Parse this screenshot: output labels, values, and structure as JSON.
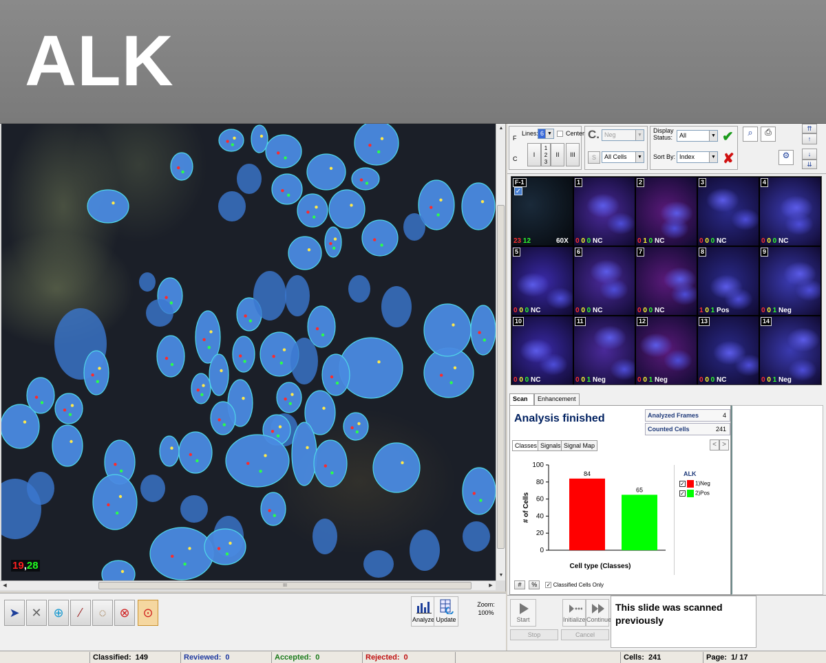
{
  "banner": {
    "title": "ALK"
  },
  "viewer": {
    "count_red": "19",
    "count_sep": ",",
    "count_green": "28",
    "hscroll_grip": "III"
  },
  "toolbar": {
    "analyze_label": "Analyze",
    "update_label": "Update",
    "zoom_label": "Zoom:",
    "zoom_value": "100%"
  },
  "controls": {
    "f_label": "F",
    "c_label": "C",
    "lines_label": "Lines:",
    "lines_value": "6",
    "center_label": "Center",
    "line_options": [
      "I",
      "1\n2\n3",
      "II",
      "III"
    ],
    "c_big": "C.",
    "neg_select": "Neg",
    "s_button": "S",
    "cells_select": "All Cells",
    "display_status_label": "Display Status:",
    "display_status_value": "All",
    "sort_by_label": "Sort By:",
    "sort_by_value": "Index"
  },
  "thumbnails": [
    {
      "num": "F-1",
      "c1": "23",
      "c2": "12",
      "c3": "",
      "label": "60X"
    },
    {
      "num": "1",
      "c1": "0",
      "c2": "0",
      "c3": "0",
      "label": "NC"
    },
    {
      "num": "2",
      "c1": "0",
      "c2": "1",
      "c3": "0",
      "label": "NC"
    },
    {
      "num": "3",
      "c1": "0",
      "c2": "0",
      "c3": "0",
      "label": "NC"
    },
    {
      "num": "4",
      "c1": "0",
      "c2": "0",
      "c3": "0",
      "label": "NC"
    },
    {
      "num": "5",
      "c1": "0",
      "c2": "0",
      "c3": "0",
      "label": "NC"
    },
    {
      "num": "6",
      "c1": "0",
      "c2": "0",
      "c3": "0",
      "label": "NC"
    },
    {
      "num": "7",
      "c1": "0",
      "c2": "0",
      "c3": "0",
      "label": "NC"
    },
    {
      "num": "8",
      "c1": "1",
      "c2": "0",
      "c3": "1",
      "label": "Pos"
    },
    {
      "num": "9",
      "c1": "0",
      "c2": "0",
      "c3": "1",
      "label": "Neg"
    },
    {
      "num": "10",
      "c1": "0",
      "c2": "0",
      "c3": "0",
      "label": "NC"
    },
    {
      "num": "11",
      "c1": "0",
      "c2": "0",
      "c3": "1",
      "label": "Neg"
    },
    {
      "num": "12",
      "c1": "0",
      "c2": "0",
      "c3": "1",
      "label": "Neg"
    },
    {
      "num": "13",
      "c1": "0",
      "c2": "0",
      "c3": "0",
      "label": "NC"
    },
    {
      "num": "14",
      "c1": "0",
      "c2": "0",
      "c3": "1",
      "label": "Neg"
    }
  ],
  "analysis": {
    "tabs": [
      "Scan",
      "Enhancement"
    ],
    "status": "Analysis finished",
    "analyzed_frames_label": "Analyzed Frames",
    "analyzed_frames_value": "4",
    "counted_cells_label": "Counted Cells",
    "counted_cells_value": "241",
    "subtabs": [
      "Classes",
      "Signals",
      "Signal Map"
    ],
    "nav_prev": "<",
    "nav_next": ">",
    "footer_hash": "#",
    "footer_pct": "%",
    "classified_only_label": "Classified Cells Only"
  },
  "chart_data": {
    "type": "bar",
    "categories": [
      "1)Neg",
      "2)Pos"
    ],
    "values": [
      84,
      65
    ],
    "colors": [
      "#ff0000",
      "#00ff00"
    ],
    "xlabel": "Cell type (Classes)",
    "ylabel": "# of Cells",
    "ylim": [
      0,
      100
    ],
    "yticks": [
      0,
      20,
      40,
      60,
      80,
      100
    ],
    "legend_title": "ALK",
    "legend": [
      "1)Neg",
      "2)Pos"
    ],
    "grid": false
  },
  "scan": {
    "start_label": "Start",
    "initialize_label": "Initialize",
    "continue_label": "Continue",
    "stop_label": "Stop",
    "cancel_label": "Cancel",
    "message": "This slide was scanned previously"
  },
  "status": {
    "classified_label": "Classified:",
    "classified_value": "149",
    "reviewed_label": "Reviewed:",
    "reviewed_value": "0",
    "accepted_label": "Accepted:",
    "accepted_value": "0",
    "rejected_label": "Rejected:",
    "rejected_value": "0",
    "cells_label": "Cells:",
    "cells_value": "241",
    "page_label": "Page:",
    "page_value": "1/ 17"
  },
  "colors": {
    "reviewed": "#1f3aa0",
    "accepted": "#1a7a1a",
    "rejected": "#c01010",
    "nucleus": "#4d8fe0",
    "outline": "#4fd8e8"
  }
}
